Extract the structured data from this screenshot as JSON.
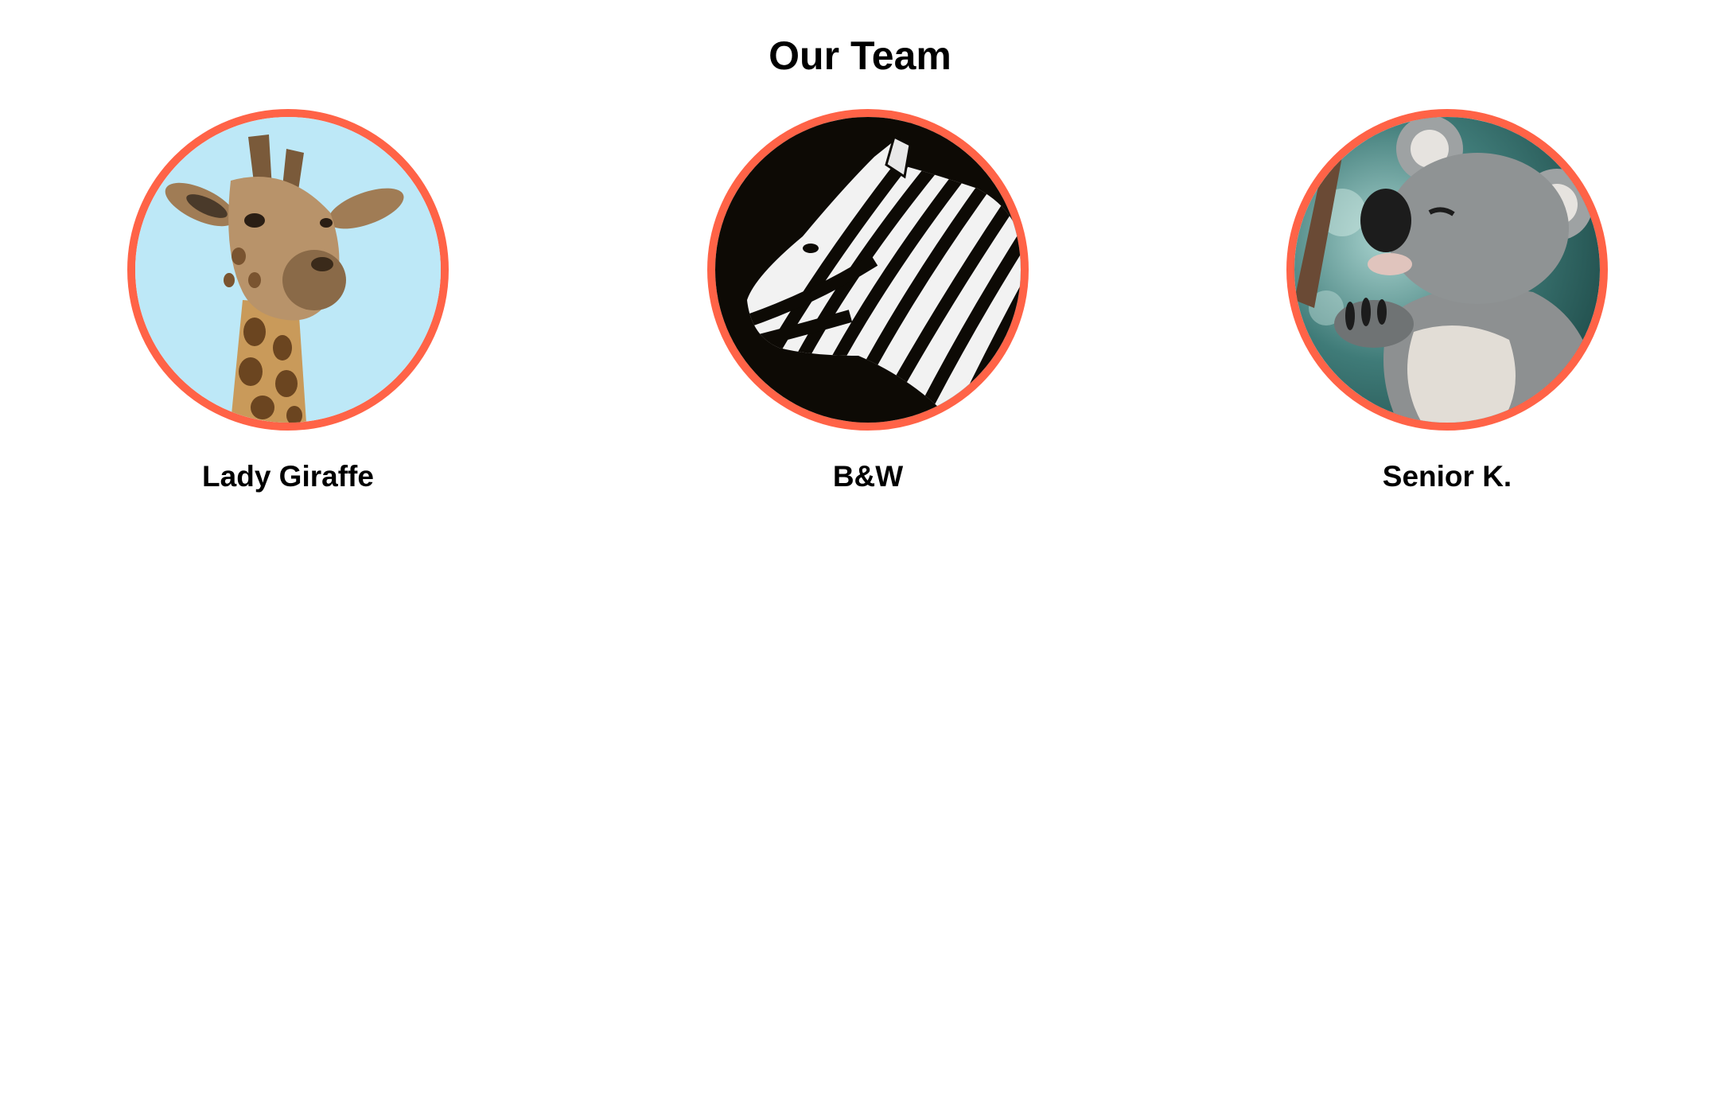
{
  "page": {
    "title": "Our Team"
  },
  "theme": {
    "accent_border": "#ff6347",
    "text": "#000000",
    "background": "#ffffff"
  },
  "team": [
    {
      "name": "Lady Giraffe",
      "photo": "giraffe-photo"
    },
    {
      "name": "B&W",
      "photo": "zebra-photo"
    },
    {
      "name": "Senior K.",
      "photo": "koala-photo"
    }
  ]
}
